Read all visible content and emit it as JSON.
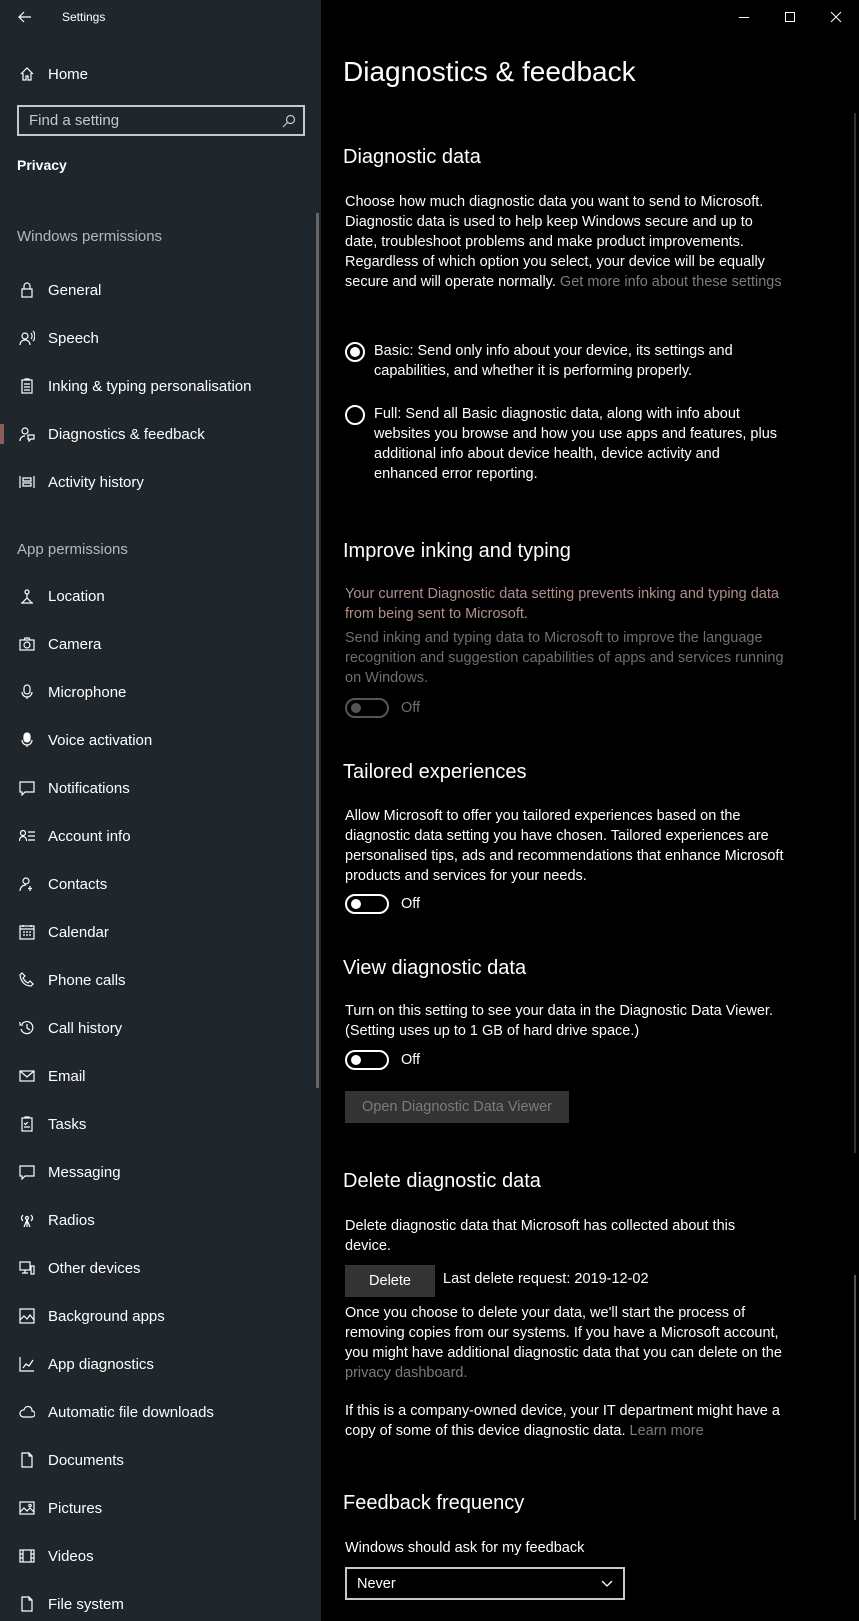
{
  "app": {
    "title": "Settings"
  },
  "sidebar": {
    "home_label": "Home",
    "search_placeholder": "Find a setting",
    "section_title": "Privacy",
    "windows_permissions_title": "Windows permissions",
    "windows_permissions": [
      {
        "label": "General",
        "icon": "lock-icon"
      },
      {
        "label": "Speech",
        "icon": "speech-icon"
      },
      {
        "label": "Inking & typing personalisation",
        "icon": "clipboard-icon"
      },
      {
        "label": "Diagnostics & feedback",
        "icon": "feedback-icon",
        "selected": true
      },
      {
        "label": "Activity history",
        "icon": "timeline-icon"
      }
    ],
    "app_permissions_title": "App permissions",
    "app_permissions": [
      {
        "label": "Location",
        "icon": "location-icon"
      },
      {
        "label": "Camera",
        "icon": "camera-icon"
      },
      {
        "label": "Microphone",
        "icon": "microphone-icon"
      },
      {
        "label": "Voice activation",
        "icon": "voice-activation-icon"
      },
      {
        "label": "Notifications",
        "icon": "notifications-icon"
      },
      {
        "label": "Account info",
        "icon": "account-info-icon"
      },
      {
        "label": "Contacts",
        "icon": "contacts-icon"
      },
      {
        "label": "Calendar",
        "icon": "calendar-icon"
      },
      {
        "label": "Phone calls",
        "icon": "phone-icon"
      },
      {
        "label": "Call history",
        "icon": "history-icon"
      },
      {
        "label": "Email",
        "icon": "email-icon"
      },
      {
        "label": "Tasks",
        "icon": "tasks-icon"
      },
      {
        "label": "Messaging",
        "icon": "messaging-icon"
      },
      {
        "label": "Radios",
        "icon": "radio-icon"
      },
      {
        "label": "Other devices",
        "icon": "devices-icon"
      },
      {
        "label": "Background apps",
        "icon": "background-apps-icon"
      },
      {
        "label": "App diagnostics",
        "icon": "app-diagnostics-icon"
      },
      {
        "label": "Automatic file downloads",
        "icon": "cloud-icon"
      },
      {
        "label": "Documents",
        "icon": "document-icon"
      },
      {
        "label": "Pictures",
        "icon": "pictures-icon"
      },
      {
        "label": "Videos",
        "icon": "videos-icon"
      },
      {
        "label": "File system",
        "icon": "file-system-icon"
      }
    ]
  },
  "main": {
    "page_title": "Diagnostics & feedback",
    "diagnostic_data": {
      "heading": "Diagnostic data",
      "description": "Choose how much diagnostic data you want to send to Microsoft. Diagnostic data is used to help keep Windows secure and up to date, troubleshoot problems and make product improvements. Regardless of which option you select, your device will be equally secure and will operate normally.",
      "link": "Get more info about these settings",
      "options": [
        {
          "label": "Basic: Send only info about your device, its settings and capabilities, and whether it is performing properly.",
          "selected": true
        },
        {
          "label": "Full: Send all Basic diagnostic data, along with info about websites you browse and how you use apps and features, plus additional info about device health, device activity and enhanced error reporting.",
          "selected": false
        }
      ]
    },
    "inking": {
      "heading": "Improve inking and typing",
      "warning": "Your current Diagnostic data setting prevents inking and typing data from being sent to Microsoft.",
      "description": "Send inking and typing data to Microsoft to improve the language recognition and suggestion capabilities of apps and services running on Windows.",
      "toggle_state": "Off"
    },
    "tailored": {
      "heading": "Tailored experiences",
      "description": "Allow Microsoft to offer you tailored experiences based on the diagnostic data setting you have chosen. Tailored experiences are personalised tips, ads and recommendations that enhance Microsoft products and services for your needs.",
      "toggle_state": "Off"
    },
    "view": {
      "heading": "View diagnostic data",
      "description": "Turn on this setting to see your data in the Diagnostic Data Viewer. (Setting uses up to 1 GB of hard drive space.)",
      "toggle_state": "Off",
      "button": "Open Diagnostic Data Viewer"
    },
    "delete": {
      "heading": "Delete diagnostic data",
      "description": "Delete diagnostic data that Microsoft has collected about this device.",
      "button": "Delete",
      "last_request": "Last delete request: 2019-12-02",
      "info": "Once you choose to delete your data, we'll start the process of removing copies from our systems. If you have a Microsoft account, you might have additional diagnostic data that you can delete on the",
      "info_link": "privacy dashboard.",
      "company": "If this is a company-owned device, your IT department might have a copy of some of this device diagnostic data.",
      "company_link": "Learn more"
    },
    "feedback": {
      "heading": "Feedback frequency",
      "label": "Windows should ask for my feedback",
      "selected": "Never"
    }
  },
  "colors": {
    "sidebar_bg": "#1f262c",
    "main_bg": "#000000",
    "accent": "#8a5f5b",
    "link": "#7c7c7c",
    "warning": "#b08f8b"
  }
}
